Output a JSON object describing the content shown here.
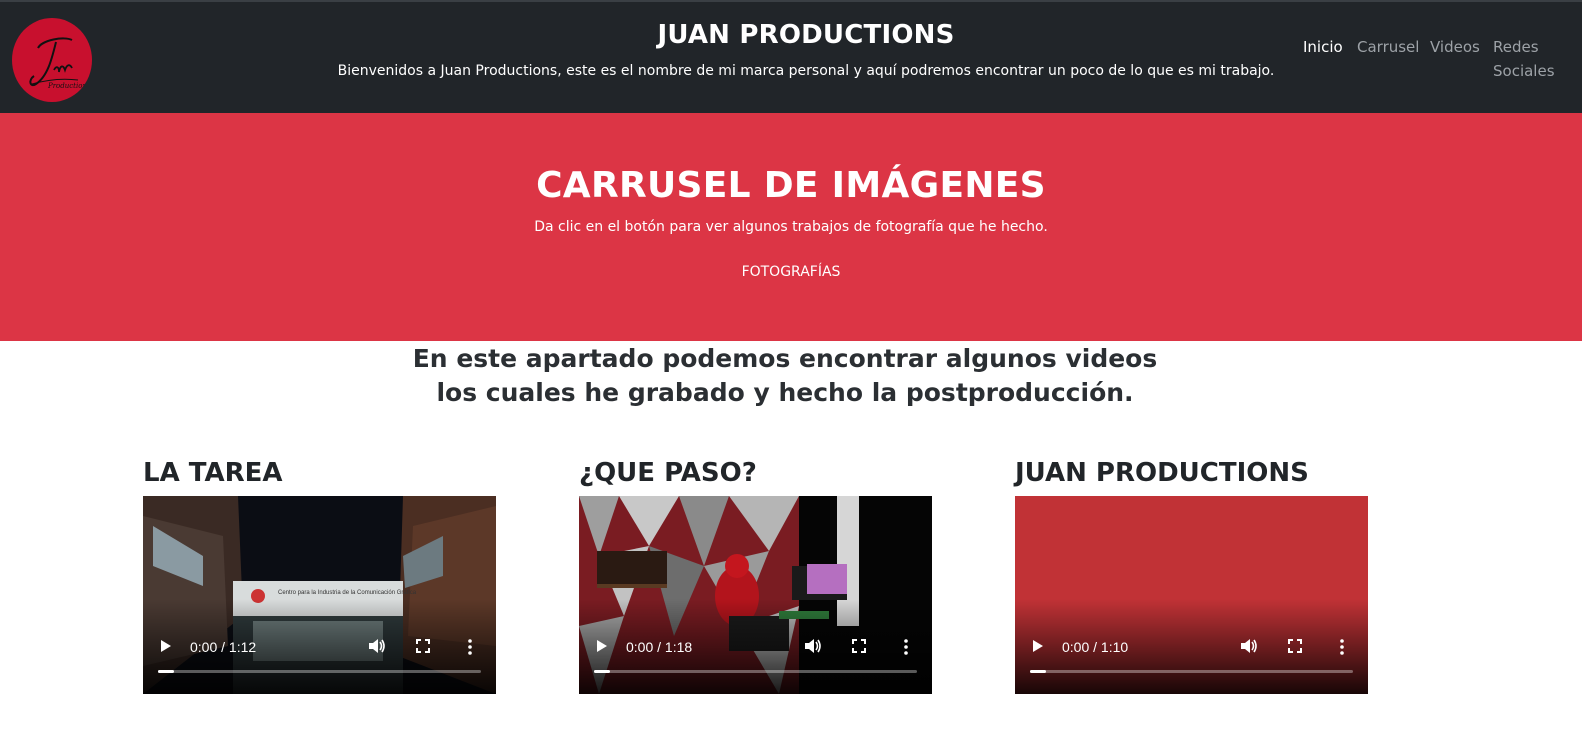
{
  "header": {
    "title": "JUAN PRODUCTIONS",
    "subtitle": "Bienvenidos a Juan Productions, este es el nombre de mi marca personal y aquí podremos encontrar un poco de lo que es mi trabajo.",
    "logo_text": "Juan Productions",
    "nav": [
      {
        "label": "Inicio",
        "active": true
      },
      {
        "label": "Carrusel",
        "active": false
      },
      {
        "label": "Videos",
        "active": false
      },
      {
        "label": "Redes",
        "active": false
      },
      {
        "label": "Sociales",
        "active": false
      }
    ]
  },
  "hero": {
    "title": "CARRUSEL DE IMÁGENES",
    "text": "Da clic en el botón para ver algunos trabajos de fotografía que he hecho.",
    "button_label": "FOTOGRAFÍAS",
    "background": "#dc3545"
  },
  "intro": {
    "line1": "En este apartado podemos encontrar algunos videos",
    "line2": "los cuales he grabado y hecho la postproducción."
  },
  "videos": [
    {
      "title": "LA TAREA",
      "time": "0:00 / 1:12",
      "sign_text": "Centro para la Industria de la Comunicación Gráfica",
      "progress": 0.05
    },
    {
      "title": "¿QUE PASO?",
      "time": "0:00 / 1:18",
      "progress": 0.05
    },
    {
      "title": "JUAN PRODUCTIONS",
      "time": "0:00 / 1:10",
      "progress": 0.05
    }
  ],
  "icons": {
    "play": "play-icon",
    "volume": "volume-icon",
    "fullscreen": "fullscreen-icon",
    "more": "more-vert-icon"
  },
  "colors": {
    "navbar": "#212529",
    "accent": "#dc3545",
    "logo": "#c8102e"
  }
}
